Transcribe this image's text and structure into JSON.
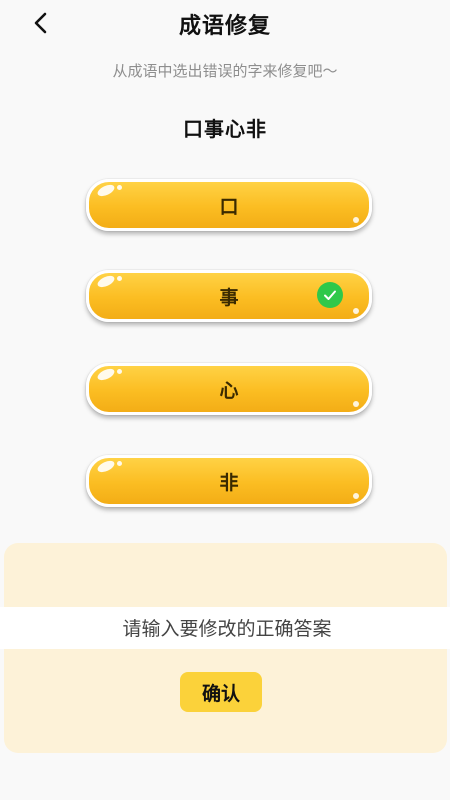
{
  "header": {
    "title": "成语修复",
    "back_icon": "chevron-left-icon"
  },
  "subtitle": "从成语中选出错误的字来修复吧～",
  "idiom": "口事心非",
  "options": [
    {
      "label": "口",
      "selected": false
    },
    {
      "label": "事",
      "selected": true
    },
    {
      "label": "心",
      "selected": false
    },
    {
      "label": "非",
      "selected": false
    }
  ],
  "answer": {
    "placeholder": "请输入要修改的正确答案",
    "value": ""
  },
  "confirm_label": "确认",
  "colors": {
    "option_bg": "#fbbd22",
    "check_bg": "#2fc84a",
    "panel_bg": "#fdf2d8",
    "confirm_bg": "#fbd23a"
  }
}
